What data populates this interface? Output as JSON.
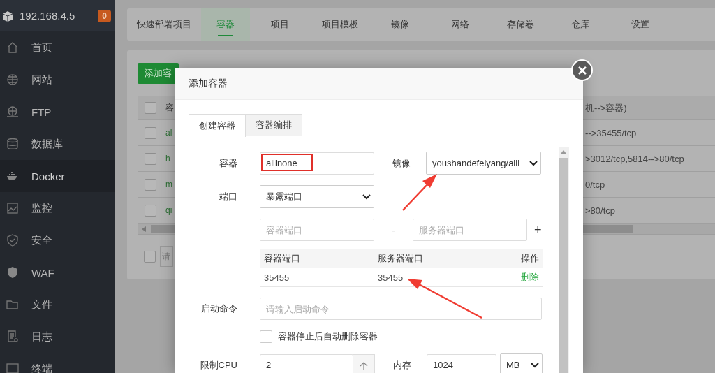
{
  "sidebar": {
    "host": "192.168.4.5",
    "badge": "0",
    "items": [
      {
        "label": "首页",
        "selected": false
      },
      {
        "label": "网站",
        "selected": false
      },
      {
        "label": "FTP",
        "selected": false
      },
      {
        "label": "数据库",
        "selected": false
      },
      {
        "label": "Docker",
        "selected": true
      },
      {
        "label": "监控",
        "selected": false
      },
      {
        "label": "安全",
        "selected": false
      },
      {
        "label": "WAF",
        "selected": false
      },
      {
        "label": "文件",
        "selected": false
      },
      {
        "label": "日志",
        "selected": false
      },
      {
        "label": "终端",
        "selected": false
      }
    ]
  },
  "tabs": [
    {
      "label": "快速部署项目",
      "selected": false
    },
    {
      "label": "容器",
      "selected": true
    },
    {
      "label": "项目",
      "selected": false
    },
    {
      "label": "项目模板",
      "selected": false
    },
    {
      "label": "镜像",
      "selected": false
    },
    {
      "label": "网络",
      "selected": false
    },
    {
      "label": "存储卷",
      "selected": false
    },
    {
      "label": "仓库",
      "selected": false
    },
    {
      "label": "设置",
      "selected": false
    }
  ],
  "panel": {
    "add_button": "添加容",
    "table": {
      "header": {
        "checked": false,
        "column_1": "容",
        "column_2": "机-->容器)"
      },
      "rows": [
        {
          "checked": false,
          "column_1": "al",
          "column_2": "-->35455/tcp"
        },
        {
          "checked": false,
          "column_1": "h",
          "column_2": ">3012/tcp,5814-->80/tcp"
        },
        {
          "checked": false,
          "column_1": "m",
          "column_2": "0/tcp"
        },
        {
          "checked": false,
          "column_1": "qi",
          "column_2": ">80/tcp"
        }
      ]
    },
    "footer": {
      "checked": false,
      "placeholder": "请"
    }
  },
  "dialog": {
    "title": "添加容器",
    "tabs": [
      {
        "label": "创建容器",
        "selected": true
      },
      {
        "label": "容器编排",
        "selected": false
      }
    ],
    "container": {
      "label": "容器",
      "value": "allinone"
    },
    "image": {
      "label": "镜像",
      "value": "youshandefeiyang/alli"
    },
    "port": {
      "label": "端口",
      "value": "暴露端口"
    },
    "container_port": {
      "placeholder": "容器端口"
    },
    "separator": "-",
    "host_port": {
      "placeholder": "服务器端口"
    },
    "add": "+",
    "port_table": {
      "columns": [
        "容器端口",
        "服务器端口",
        "操作"
      ],
      "rows": [
        {
          "container_port": "35455",
          "host_port": "35455",
          "action": "删除"
        }
      ]
    },
    "command": {
      "label": "启动命令",
      "placeholder": "请输入启动命令"
    },
    "auto_remove": {
      "label": "容器停止后自动删除容器",
      "checked": false
    },
    "cpu": {
      "label": "限制CPU",
      "value": "2"
    },
    "memory": {
      "label": "内存",
      "value": "1024",
      "unit": "MB"
    }
  }
}
